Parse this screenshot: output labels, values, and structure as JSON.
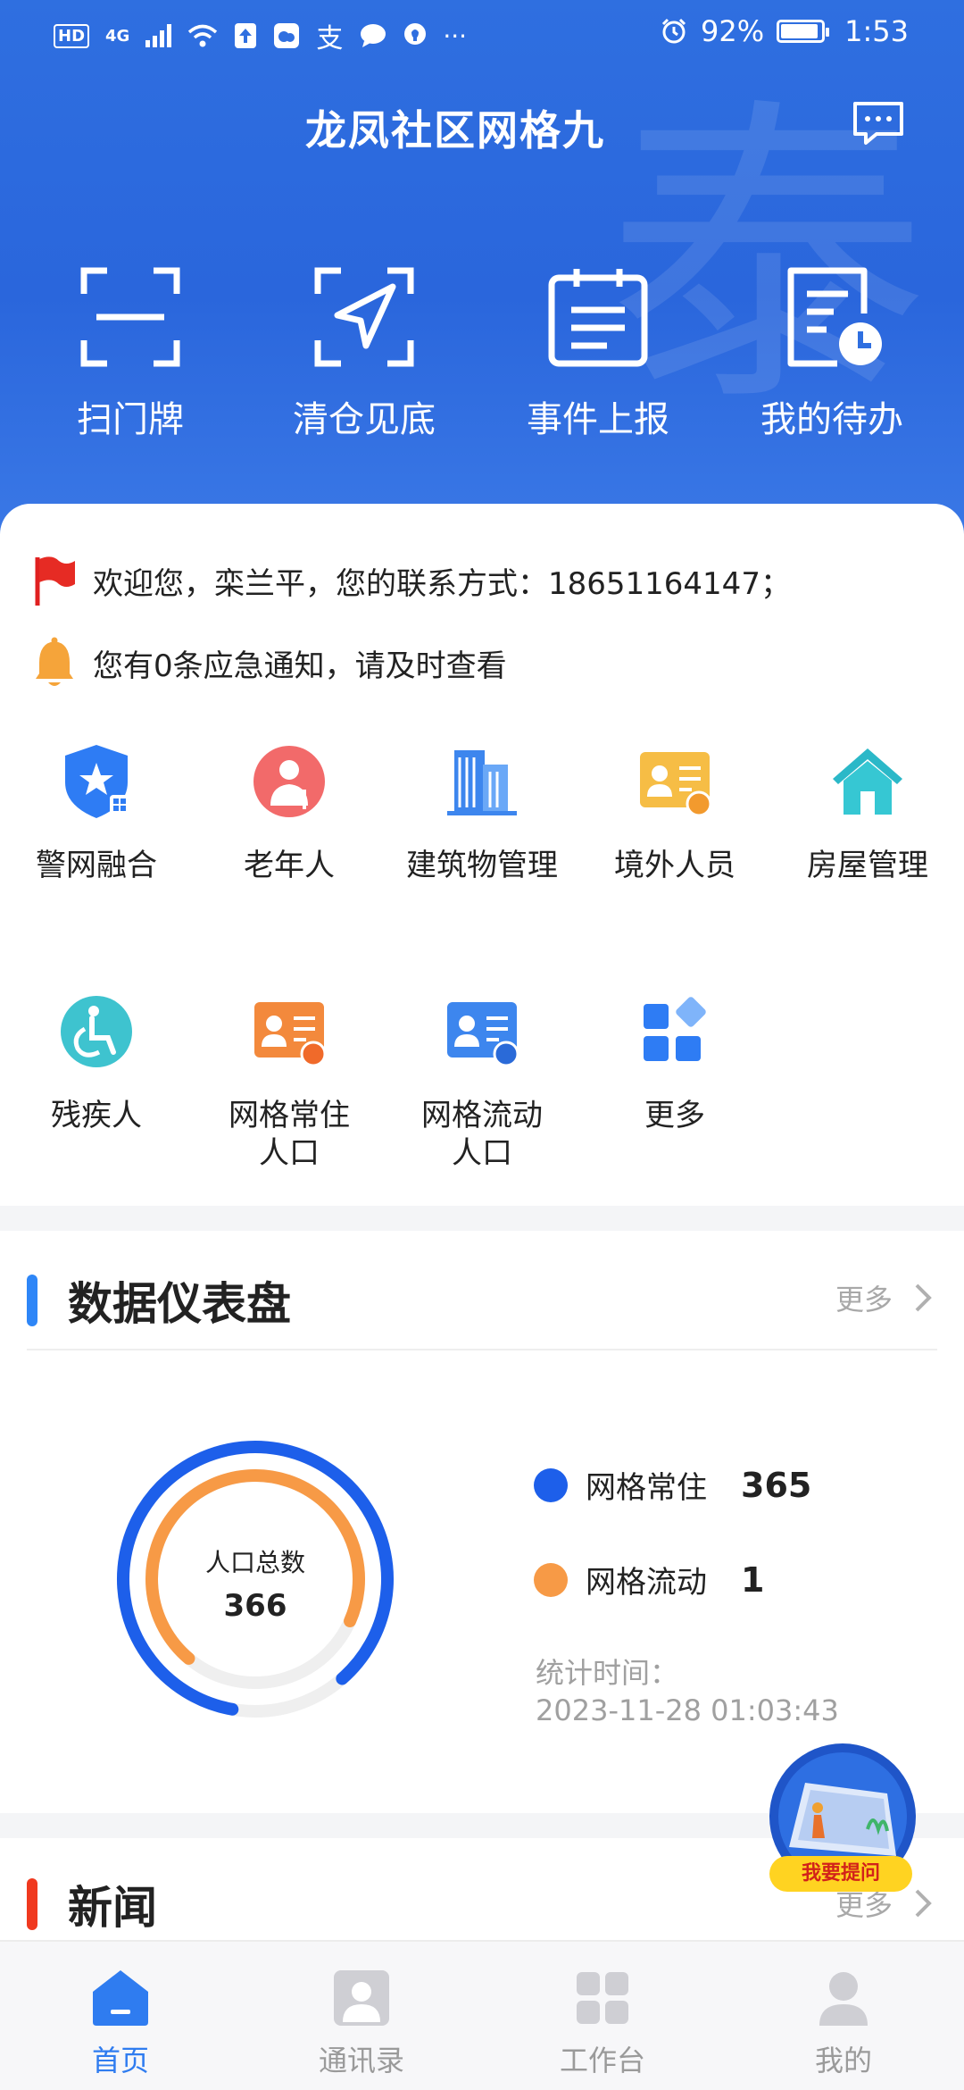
{
  "status_bar": {
    "network_badge": "HD",
    "network_type": "4G",
    "overflow": "···",
    "battery": "92%",
    "battery_level": 0.92,
    "time": "1:53"
  },
  "header": {
    "title": "龙凤社区网格九",
    "quick_actions": [
      {
        "label": "扫门牌",
        "icon": "scan-icon"
      },
      {
        "label": "清仓见底",
        "icon": "navigation-arrow-icon"
      },
      {
        "label": "事件上报",
        "icon": "clipboard-icon"
      },
      {
        "label": "我的待办",
        "icon": "todo-clock-icon"
      }
    ]
  },
  "notices": {
    "welcome": "欢迎您，栾兰平，您的联系方式：18651164147；",
    "alert": "您有0条应急通知，请及时查看"
  },
  "grid": [
    {
      "label": "警网融合",
      "icon": "police-shield-icon"
    },
    {
      "label": "老年人",
      "icon": "elderly-person-icon"
    },
    {
      "label": "建筑物管理",
      "icon": "building-icon"
    },
    {
      "label": "境外人员",
      "icon": "foreign-person-card-icon"
    },
    {
      "label": "房屋管理",
      "icon": "house-icon"
    },
    {
      "label": "残疾人",
      "icon": "wheelchair-icon"
    },
    {
      "label": "网格常住人口",
      "icon": "resident-card-icon"
    },
    {
      "label": "网格流动人口",
      "icon": "floating-person-card-icon"
    },
    {
      "label": "更多",
      "icon": "more-grid-icon"
    }
  ],
  "dashboard": {
    "title": "数据仪表盘",
    "more": "更多",
    "donut_label": "人口总数",
    "total": "366",
    "resident_label": "网格常住",
    "resident_value": "365",
    "floating_label": "网格流动",
    "floating_value": "1",
    "stat_time_label": "统计时间：",
    "stat_time": "2023-11-28 01:03:43",
    "colors": {
      "resident": "#1d5fea",
      "floating": "#f79a46"
    }
  },
  "news": {
    "title": "新闻",
    "more": "更多"
  },
  "float_button": {
    "label": "我要提问"
  },
  "tabbar": [
    {
      "label": "首页",
      "icon": "home-icon",
      "active": true
    },
    {
      "label": "通讯录",
      "icon": "contacts-icon",
      "active": false
    },
    {
      "label": "工作台",
      "icon": "workbench-icon",
      "active": false
    },
    {
      "label": "我的",
      "icon": "profile-icon",
      "active": false
    }
  ]
}
